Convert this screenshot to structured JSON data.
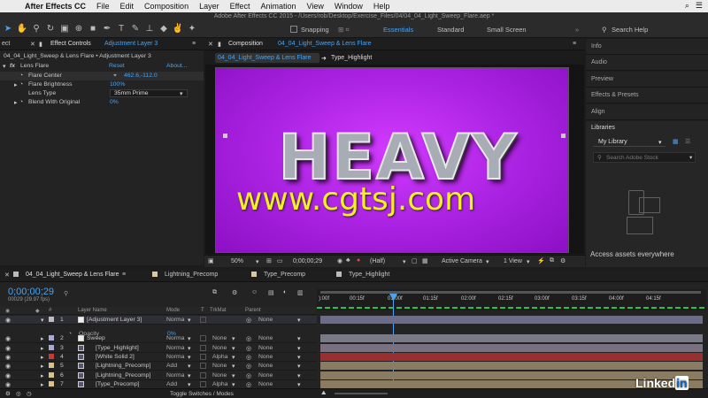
{
  "menubar": {
    "apple": "",
    "app": "After Effects CC",
    "items": [
      "File",
      "Edit",
      "Composition",
      "Layer",
      "Effect",
      "Animation",
      "View",
      "Window",
      "Help"
    ]
  },
  "titlebar": {
    "title": "Adobe After Effects CC 2015 - /Users/rob/Desktop/Exercise_Files/04/04_04_Light_Sweep_Flare.aep *"
  },
  "toolbar": {
    "snapping": "Snapping",
    "workspaces": [
      "Essentials",
      "Standard",
      "Small Screen"
    ],
    "search": "Search Help"
  },
  "effect_controls": {
    "tab_left": "ect",
    "tab": "Effect Controls",
    "tab_target": "Adjustment Layer 3",
    "breadcrumb": "04_04_Light_Sweep & Lens Flare • Adjustment Layer 3",
    "fx_name": "Lens Flare",
    "reset": "Reset",
    "about": "About...",
    "props": [
      {
        "name": "Flare Center",
        "value": "462.6,-112.0"
      },
      {
        "name": "Flare Brightness",
        "value": "100%"
      },
      {
        "name": "Lens Type",
        "value": "35mm Prime"
      },
      {
        "name": "Blend With Original",
        "value": "0%"
      }
    ]
  },
  "composition": {
    "tab": "Composition",
    "tab_name": "04_04_Light_Sweep & Lens Flare",
    "sub_tabs": [
      "04_04_Light_Sweep & Lens Flare",
      "Type_Highlight"
    ],
    "headline": "HEAVY",
    "footer": {
      "zoom": "50%",
      "timecode": "0;00;00;29",
      "resolution": "(Half)",
      "camera": "Active Camera",
      "views": "1 View"
    }
  },
  "watermark": "www.cgtsj.com",
  "right_panels": {
    "items": [
      "Info",
      "Audio",
      "Preview",
      "Effects & Presets",
      "Align"
    ],
    "libraries": "Libraries",
    "library_name": "My Library",
    "stock_search": "Search Adobe Stock",
    "access_text": "Access assets everywhere"
  },
  "timeline": {
    "tabs": [
      "04_04_Light_Sweep & Lens Flare",
      "Lightning_Precomp",
      "Type_Precomp",
      "Type_Highlight"
    ],
    "timecode": "0;00;00;29",
    "frame_info": "00029 (29.97 fps)",
    "columns": {
      "layer_name": "Layer Name",
      "mode": "Mode",
      "t": "T",
      "trkmat": "TrkMat",
      "parent": "Parent"
    },
    "ruler": [
      "):00f",
      "00:15f",
      "01:00f",
      "01:15f",
      "02:00f",
      "02:15f",
      "03:00f",
      "03:15f",
      "04:00f",
      "04:15f"
    ],
    "rows": [
      {
        "num": "1",
        "name": "[Adjustment Layer 3]",
        "mode": "Norma",
        "trkmat": "",
        "parent": "None"
      },
      {
        "num": "2",
        "name": "Sweep",
        "mode": "Norma",
        "trkmat": "None",
        "parent": "None"
      },
      {
        "num": "3",
        "name": "[Type_Highlight]",
        "mode": "Norma",
        "trkmat": "None",
        "parent": "None"
      },
      {
        "num": "4",
        "name": "[White Solid 2]",
        "mode": "Norma",
        "trkmat": "Alpha",
        "parent": "None"
      },
      {
        "num": "5",
        "name": "[Lightning_Precomp]",
        "mode": "Add",
        "trkmat": "None",
        "parent": "None"
      },
      {
        "num": "6",
        "name": "[Lightning_Precomp]",
        "mode": "Norma",
        "trkmat": "None",
        "parent": "None"
      },
      {
        "num": "7",
        "name": "[Type_Precomp]",
        "mode": "Add",
        "trkmat": "Alpha",
        "parent": "None"
      }
    ],
    "opacity_label": "Opacity",
    "opacity_value": "0%",
    "toggle": "Toggle Switches / Modes"
  },
  "colors": {
    "accent": "#4aa3f0",
    "comp_bg": "#a821e0",
    "watermark": "#f6ef24"
  },
  "linkedin": "Linked in"
}
